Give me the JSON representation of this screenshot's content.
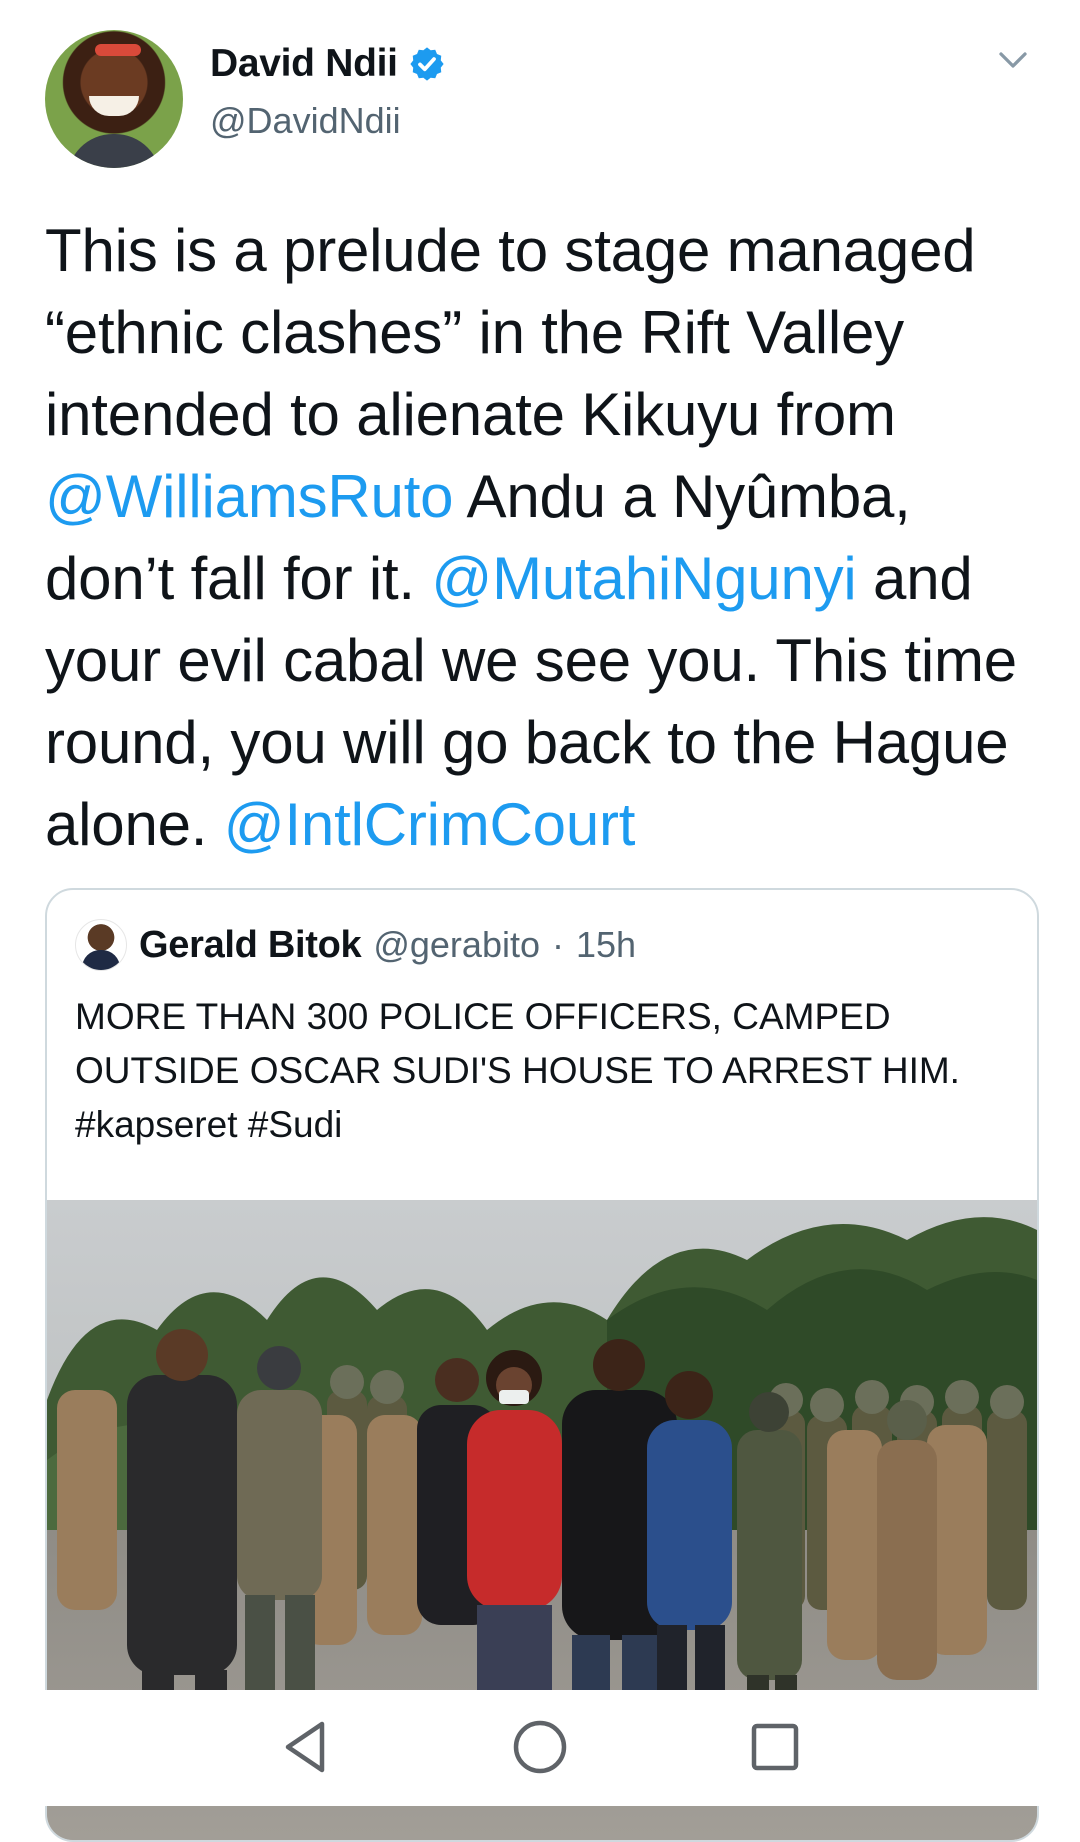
{
  "tweet": {
    "author": {
      "display_name": "David Ndii",
      "handle": "@DavidNdii",
      "verified": true,
      "avatar_icon": "profile-photo"
    },
    "text_segments": [
      {
        "text": "This is a prelude to stage managed “ethnic clashes” in the Rift Valley intended to alienate Kikuyu from ",
        "type": "text"
      },
      {
        "text": "@WilliamsRuto",
        "type": "mention"
      },
      {
        "text": " Andu a Nyûmba, don’t fall for it. ",
        "type": "text"
      },
      {
        "text": "@MutahiNgunyi",
        "type": "mention"
      },
      {
        "text": " and your evil cabal we see you. This time round, you will go back to the Hague alone. ",
        "type": "text"
      },
      {
        "text": "@IntlCrimCourt",
        "type": "mention"
      }
    ],
    "menu_icon": "chevron-down-icon"
  },
  "quoted_tweet": {
    "display_name": "Gerald Bitok",
    "handle": "@gerabito",
    "separator": "·",
    "time": "15h",
    "text": "MORE THAN 300 POLICE OFFICERS, CAMPED OUTSIDE OSCAR SUDI'S HOUSE TO ARREST HIM. #kapseret #Sudi",
    "media": "photo of police officers gathered outdoors"
  },
  "colors": {
    "mention": "#1d9bf0",
    "verified": "#1d9bf0",
    "secondary_text": "#536471",
    "border": "#cfd9de"
  },
  "nav": {
    "back_icon": "back-triangle-icon",
    "home_icon": "home-circle-icon",
    "recents_icon": "recents-square-icon"
  }
}
